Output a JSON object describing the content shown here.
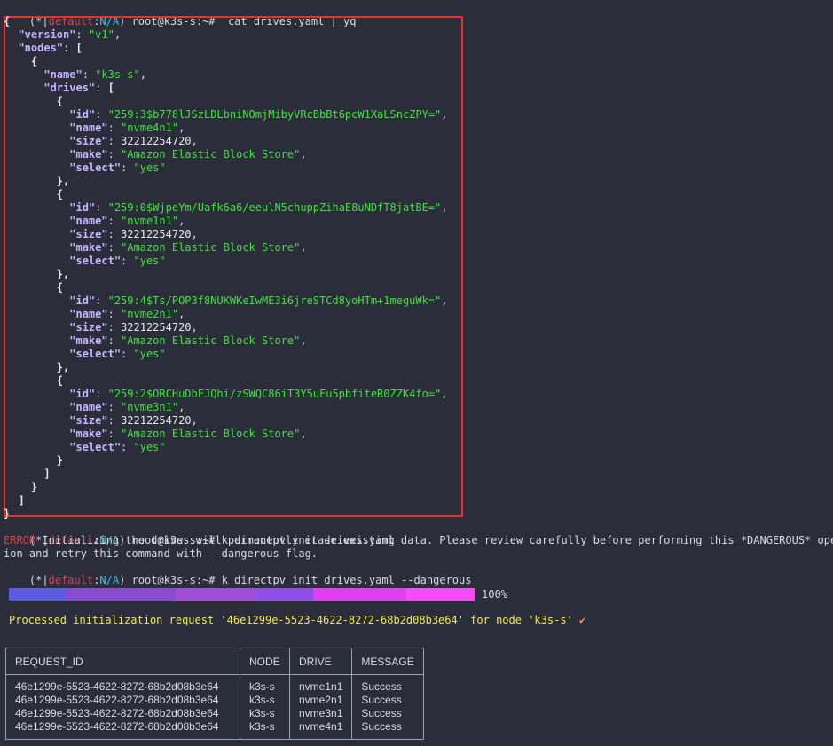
{
  "prompt": {
    "open": "(",
    "star": "*",
    "sep": "|",
    "context": "default",
    "colon": ":",
    "namespace": "N/A",
    "close": ")",
    "user_host": " root@k3s-s:~# "
  },
  "commands": {
    "cat": " cat drives.yaml | yq",
    "init": "k directpv init drives.yaml",
    "init_dangerous": "k directpv init drives.yaml --dangerous"
  },
  "json_output": {
    "open_marker": "{",
    "close_marker": "}",
    "version_key": "\"version\"",
    "version_value": "\"v1\"",
    "nodes_key": "\"nodes\"",
    "node_name_key": "\"name\"",
    "node_name_value": "\"k3s-s\"",
    "drives_key": "\"drives\"",
    "drives": [
      {
        "id": "\"259:3$b778lJSzLDLbniNOmjMibyVRcBbBt6pcW1XaLSncZPY=\"",
        "name": "\"nvme4n1\"",
        "size": "32212254720",
        "make": "\"Amazon Elastic Block Store\"",
        "select": "\"yes\""
      },
      {
        "id": "\"259:0$WjpeYm/Uafk6a6/eeulN5chuppZihaE8uNDfT8jatBE=\"",
        "name": "\"nvme1n1\"",
        "size": "32212254720",
        "make": "\"Amazon Elastic Block Store\"",
        "select": "\"yes\""
      },
      {
        "id": "\"259:4$Ts/POP3f8NUKWKeIwME3i6jreSTCd8yoHTm+1meguWk=\"",
        "name": "\"nvme2n1\"",
        "size": "32212254720",
        "make": "\"Amazon Elastic Block Store\"",
        "select": "\"yes\""
      },
      {
        "id": "\"259:2$ORCHuDbFJQhi/zSWQC86iT3Y5uFu5pbfiteR0ZZK4fo=\"",
        "name": "\"nvme3n1\"",
        "size": "32212254720",
        "make": "\"Amazon Elastic Block Store\"",
        "select": "\"yes\""
      }
    ],
    "keys": {
      "id": "\"id\"",
      "name": "\"name\"",
      "size": "\"size\"",
      "make": "\"make\"",
      "select": "\"select\""
    }
  },
  "error": {
    "label": "ERROR",
    "line1": " Initializing the drives will permanently erase existing data. Please review carefully before performing this *DANGEROUS* operat",
    "line2": "ion and retry this command with --dangerous flag."
  },
  "progress": {
    "percent_label": "100%",
    "value": 1.0,
    "colors": [
      "#5c5ce0",
      "#8a4ccf",
      "#a24fd8",
      "#8e4fe8",
      "#e040f0",
      "#f64cf5"
    ]
  },
  "processed_message": "Processed initialization request '46e1299e-5523-4622-8272-68b2d08b3e64' for node 'k3s-s' ",
  "check_mark": "✔",
  "result_table": {
    "headers": [
      "REQUEST_ID",
      "NODE",
      "DRIVE",
      "MESSAGE"
    ],
    "rows": [
      [
        "46e1299e-5523-4622-8272-68b2d08b3e64",
        "k3s-s",
        "nvme1n1",
        "Success"
      ],
      [
        "46e1299e-5523-4622-8272-68b2d08b3e64",
        "k3s-s",
        "nvme2n1",
        "Success"
      ],
      [
        "46e1299e-5523-4622-8272-68b2d08b3e64",
        "k3s-s",
        "nvme3n1",
        "Success"
      ],
      [
        "46e1299e-5523-4622-8272-68b2d08b3e64",
        "k3s-s",
        "nvme4n1",
        "Success"
      ]
    ]
  },
  "colors": {
    "background": "#2b2d3a",
    "highlight_box": "#e5342b",
    "json_key": "#c9b4ff",
    "json_string": "#3ee33a",
    "error": "#d9434f",
    "success_message": "#f3e94a"
  }
}
